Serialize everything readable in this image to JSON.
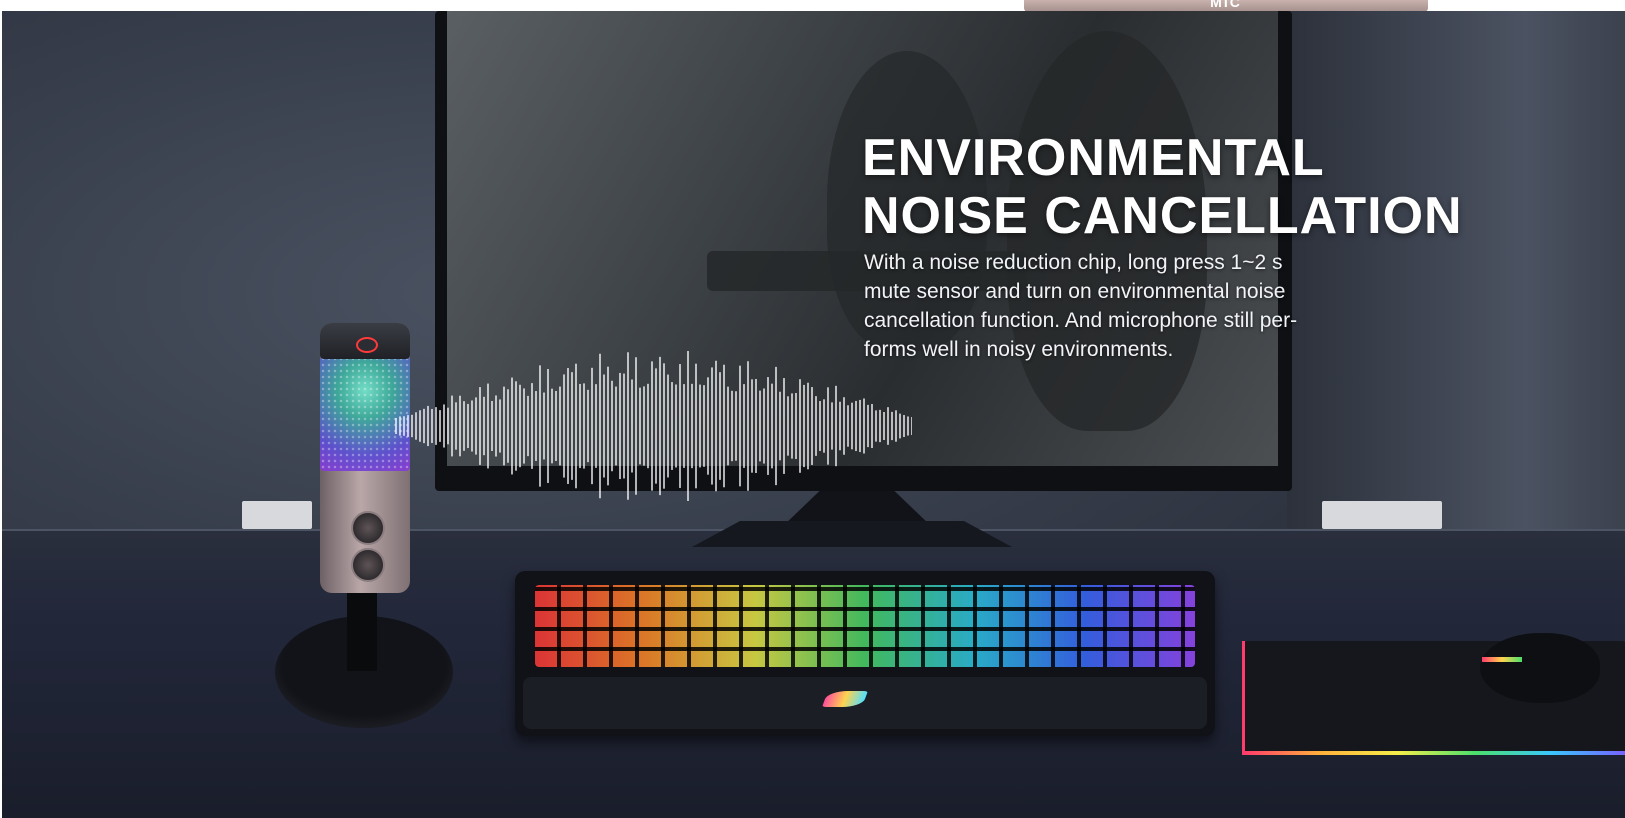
{
  "top_tab": {
    "label": "MIC"
  },
  "banner": {
    "headline_lines": [
      "ENVIRONMENTAL",
      "NOISE CANCELLATION"
    ],
    "body_lines": [
      "With a noise reduction chip, long press 1~2 s",
      "mute sensor and turn on environmental noise",
      "cancellation function. And microphone still per-",
      "forms well in noisy environments."
    ]
  },
  "colors": {
    "accent_red": "#ff3a3a",
    "rgb_pink": "#ff3b6b",
    "rgb_cyan": "#3ac6ff",
    "rgb_purple": "#7a5cff"
  },
  "icons": [
    "mute-sensor-icon",
    "brand-logo-icon",
    "sound-wave-icon"
  ]
}
